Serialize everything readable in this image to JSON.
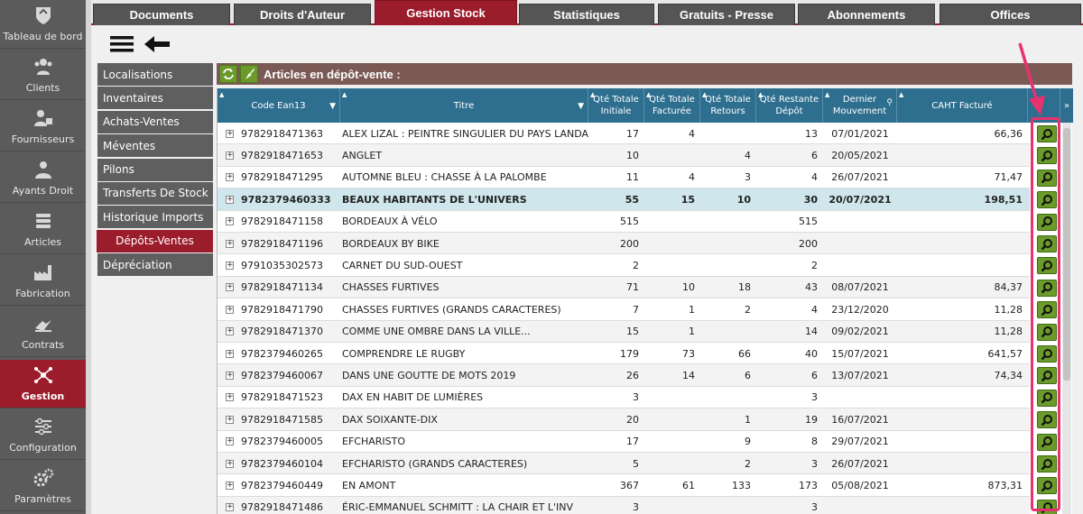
{
  "sidebar": {
    "items": [
      {
        "label": "Tableau de bord",
        "icon": "dashboard-icon"
      },
      {
        "label": "Clients",
        "icon": "clients-icon"
      },
      {
        "label": "Fournisseurs",
        "icon": "suppliers-icon"
      },
      {
        "label": "Ayants Droit",
        "icon": "rights-holders-icon"
      },
      {
        "label": "Articles",
        "icon": "articles-icon"
      },
      {
        "label": "Fabrication",
        "icon": "factory-icon"
      },
      {
        "label": "Contrats",
        "icon": "contract-icon"
      },
      {
        "label": "Gestion",
        "icon": "gestion-icon",
        "active": true
      },
      {
        "label": "Configuration",
        "icon": "sliders-icon"
      },
      {
        "label": "Paramètres",
        "icon": "gears-icon"
      }
    ]
  },
  "tabs": [
    "Documents",
    "Droits d'Auteur",
    "Gestion Stock",
    "Statistiques",
    "Gratuits - Presse",
    "Abonnements",
    "Offices"
  ],
  "active_tab": "Gestion Stock",
  "submenu": [
    "Localisations",
    "Inventaires",
    "Achats-Ventes",
    "Méventes",
    "Pilons",
    "Transferts De Stock",
    "Historique Imports",
    "Dépôts-Ventes",
    "Dépréciation"
  ],
  "active_submenu": "Dépôts-Ventes",
  "content_title": "Articles en dépôt-vente :",
  "columns": {
    "ean": "Code Ean13",
    "titre": "Titre",
    "qte_init_1": "Qté Totale",
    "qte_init_2": "Initiale",
    "qte_fact_1": "Qté Totale",
    "qte_fact_2": "Facturée",
    "qte_ret_1": "Qté Totale",
    "qte_ret_2": "Retours",
    "qte_rest_1": "Qté Restante",
    "qte_rest_2": "Dépôt",
    "mouv_1": "Dernier",
    "mouv_2": "Mouvement",
    "caht": "CAHT Facturé"
  },
  "rows": [
    {
      "ean": "9782918471363",
      "titre": "ALEX LIZAL : PEINTRE SINGULIER DU PAYS LANDAI",
      "init": "17",
      "fact": "4",
      "ret": "",
      "rest": "13",
      "mouv": "07/01/2021",
      "caht": "66,36"
    },
    {
      "ean": "9782918471653",
      "titre": "ANGLET",
      "init": "10",
      "fact": "",
      "ret": "4",
      "rest": "6",
      "mouv": "20/05/2021",
      "caht": ""
    },
    {
      "ean": "9782918471295",
      "titre": "AUTOMNE BLEU : CHASSE À LA PALOMBE",
      "init": "11",
      "fact": "4",
      "ret": "3",
      "rest": "4",
      "mouv": "26/07/2021",
      "caht": "71,47"
    },
    {
      "ean": "9782379460333",
      "titre": "BEAUX HABITANTS DE L'UNIVERS",
      "init": "55",
      "fact": "15",
      "ret": "10",
      "rest": "30",
      "mouv": "20/07/2021",
      "caht": "198,51",
      "selected": true
    },
    {
      "ean": "9782918471158",
      "titre": "BORDEAUX À VÉLO",
      "init": "515",
      "fact": "",
      "ret": "",
      "rest": "515",
      "mouv": "",
      "caht": ""
    },
    {
      "ean": "9782918471196",
      "titre": "BORDEAUX BY BIKE",
      "init": "200",
      "fact": "",
      "ret": "",
      "rest": "200",
      "mouv": "",
      "caht": ""
    },
    {
      "ean": "9791035302573",
      "titre": "CARNET DU SUD-OUEST",
      "init": "2",
      "fact": "",
      "ret": "",
      "rest": "2",
      "mouv": "",
      "caht": ""
    },
    {
      "ean": "9782918471134",
      "titre": "CHASSES FURTIVES",
      "init": "71",
      "fact": "10",
      "ret": "18",
      "rest": "43",
      "mouv": "08/07/2021",
      "caht": "84,37"
    },
    {
      "ean": "9782918471790",
      "titre": "CHASSES FURTIVES (GRANDS CARACTERES)",
      "init": "7",
      "fact": "1",
      "ret": "2",
      "rest": "4",
      "mouv": "23/12/2020",
      "caht": "11,28"
    },
    {
      "ean": "9782918471370",
      "titre": "COMME UNE OMBRE DANS LA VILLE...",
      "init": "15",
      "fact": "1",
      "ret": "",
      "rest": "14",
      "mouv": "09/02/2021",
      "caht": "11,28"
    },
    {
      "ean": "9782379460265",
      "titre": "COMPRENDRE LE RUGBY",
      "init": "179",
      "fact": "73",
      "ret": "66",
      "rest": "40",
      "mouv": "15/07/2021",
      "caht": "641,57"
    },
    {
      "ean": "9782379460067",
      "titre": "DANS UNE GOUTTE DE MOTS 2019",
      "init": "26",
      "fact": "14",
      "ret": "6",
      "rest": "6",
      "mouv": "13/07/2021",
      "caht": "74,34"
    },
    {
      "ean": "9782918471523",
      "titre": "DAX EN HABIT DE LUMIÈRES",
      "init": "3",
      "fact": "",
      "ret": "",
      "rest": "3",
      "mouv": "",
      "caht": ""
    },
    {
      "ean": "9782918471585",
      "titre": "DAX SOIXANTE-DIX",
      "init": "20",
      "fact": "",
      "ret": "1",
      "rest": "19",
      "mouv": "16/07/2021",
      "caht": ""
    },
    {
      "ean": "9782379460005",
      "titre": "EFCHARISTO",
      "init": "17",
      "fact": "",
      "ret": "9",
      "rest": "8",
      "mouv": "29/07/2021",
      "caht": ""
    },
    {
      "ean": "9782379460104",
      "titre": "EFCHARISTO (GRANDS CARACTERES)",
      "init": "5",
      "fact": "",
      "ret": "2",
      "rest": "3",
      "mouv": "26/07/2021",
      "caht": ""
    },
    {
      "ean": "9782379460449",
      "titre": "EN AMONT",
      "init": "367",
      "fact": "61",
      "ret": "133",
      "rest": "173",
      "mouv": "05/08/2021",
      "caht": "873,31"
    },
    {
      "ean": "9782918471486",
      "titre": "ÉRIC-EMMANUEL SCHMITT : LA CHAIR ET L'INV",
      "init": "3",
      "fact": "",
      "ret": "",
      "rest": "3",
      "mouv": "",
      "caht": ""
    }
  ]
}
